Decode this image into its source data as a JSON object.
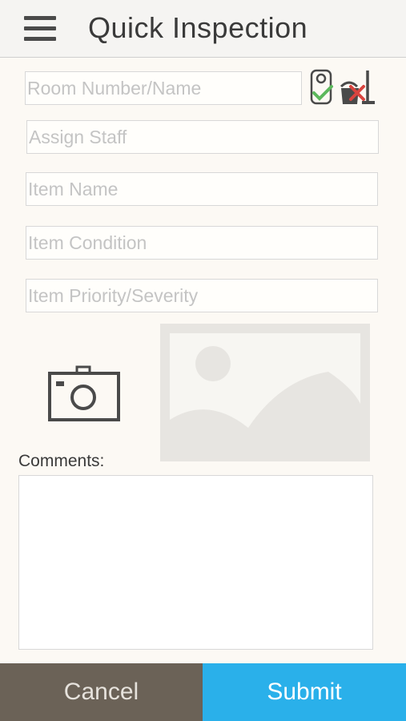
{
  "header": {
    "title": "Quick Inspection",
    "menu_icon": "hamburger-menu-icon"
  },
  "form": {
    "room": {
      "placeholder": "Room Number/Name",
      "value": ""
    },
    "assign_staff": {
      "placeholder": "Assign Staff",
      "value": ""
    },
    "item_name": {
      "placeholder": "Item Name",
      "value": ""
    },
    "item_condition": {
      "placeholder": "Item Condition",
      "value": ""
    },
    "item_priority": {
      "placeholder": "Item Priority/Severity",
      "value": ""
    },
    "comments_label": "Comments:",
    "comments_value": ""
  },
  "icons": {
    "room_status": "door-hanger-check-icon",
    "cleaning_status": "cleaning-bucket-x-icon",
    "camera": "camera-icon",
    "photo": "image-placeholder-icon"
  },
  "footer": {
    "cancel_label": "Cancel",
    "submit_label": "Submit"
  },
  "colors": {
    "submit_bg": "#2ab0ea",
    "cancel_bg": "#6b6257",
    "background": "#fcf9f4",
    "check_green": "#5cb85c",
    "x_red": "#d9443f"
  }
}
